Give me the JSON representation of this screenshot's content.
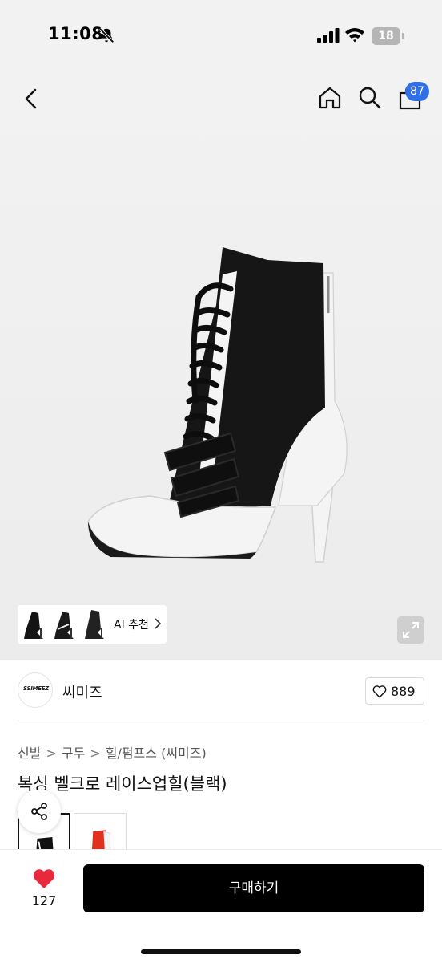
{
  "status_bar": {
    "time": "11:08",
    "battery": "18",
    "icons": [
      "bell-off-icon",
      "signal-icon",
      "wifi-icon",
      "battery-icon"
    ]
  },
  "nav": {
    "icons": [
      "back-icon",
      "home-icon",
      "search-icon",
      "shopping-bag-icon"
    ],
    "cart_count": "87",
    "badge_color": "#2f6fe8"
  },
  "gallery": {
    "ai_recommend_label": "AI 추천",
    "icons": [
      "chevron-right-icon",
      "expand-icon"
    ]
  },
  "seller": {
    "logo_text": "SSIMEEZ",
    "name": "씨미즈",
    "like_count": "889"
  },
  "breadcrumb": [
    "신발",
    "구두",
    "힐/펌프스 (씨미즈)"
  ],
  "product": {
    "title": "복싱 벨크로 레이스업힐(블랙)",
    "color_options": [
      "black",
      "red"
    ]
  },
  "bottom_bar": {
    "wish_count": "127",
    "wish_color": "#e8283c",
    "buy_label": "구매하기"
  }
}
